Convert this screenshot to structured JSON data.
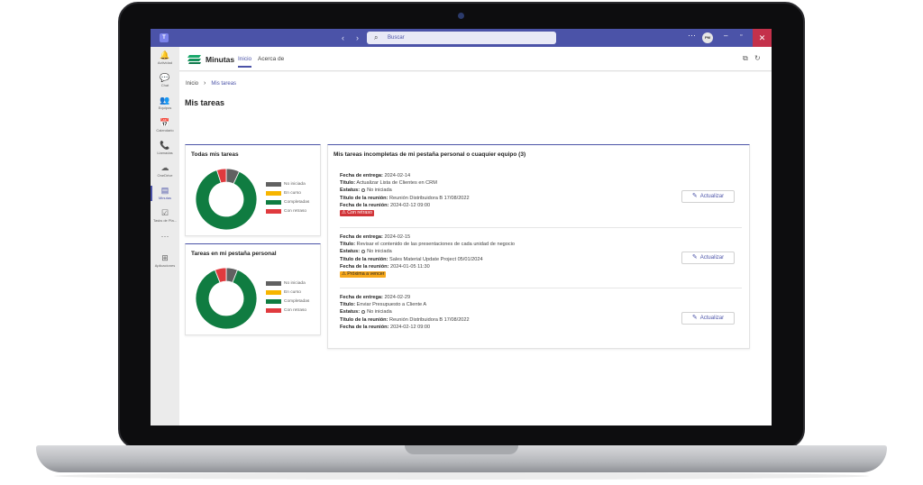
{
  "titlebar": {
    "logo": "T",
    "back_icon": "chevron-left-icon",
    "forward_icon": "chevron-right-icon",
    "search_placeholder": "Buscar",
    "more": "···",
    "avatar_initials": "PM"
  },
  "rail": {
    "items": [
      {
        "label": "Actividad",
        "icon": "bell-icon",
        "glyph": "🔔"
      },
      {
        "label": "Chat",
        "icon": "chat-icon",
        "glyph": "💬"
      },
      {
        "label": "Equipos",
        "icon": "teams-icon",
        "glyph": "👥"
      },
      {
        "label": "Calendario",
        "icon": "calendar-icon",
        "glyph": "📅"
      },
      {
        "label": "Llamadas",
        "icon": "phone-icon",
        "glyph": "📞"
      },
      {
        "label": "OneDrive",
        "icon": "cloud-icon",
        "glyph": "☁"
      },
      {
        "label": "Minutas",
        "icon": "minutas-icon",
        "glyph": "▤"
      },
      {
        "label": "Tasks de Pla...",
        "icon": "tasks-icon",
        "glyph": "☑"
      },
      {
        "label": "",
        "icon": "more-icon",
        "glyph": "···"
      },
      {
        "label": "Aplicaciones",
        "icon": "add-apps-icon",
        "glyph": "⊞"
      }
    ]
  },
  "app": {
    "name": "Minutas",
    "tabs": [
      "Inicio",
      "Acerca de"
    ]
  },
  "breadcrumb": {
    "home": "Inicio",
    "current": "Mis tareas"
  },
  "page_title": "Mis tareas",
  "legend": [
    {
      "label": "No iniciada",
      "color": "#616161"
    },
    {
      "label": "En curso",
      "color": "#f7b500"
    },
    {
      "label": "Completadas",
      "color": "#107c41"
    },
    {
      "label": "Con retraso",
      "color": "#e03a3e"
    }
  ],
  "chart_data": [
    {
      "type": "pie",
      "title": "Todas mis tareas",
      "categories": [
        "No iniciada",
        "En curso",
        "Completadas",
        "Con retraso"
      ],
      "values": [
        7,
        0,
        88,
        5
      ]
    },
    {
      "type": "pie",
      "title": "Tareas en mi pestaña personal",
      "categories": [
        "No iniciada",
        "En curso",
        "Completadas",
        "Con retraso"
      ],
      "values": [
        6,
        0,
        88,
        6
      ]
    }
  ],
  "tasks_panel": {
    "title": "Mis tareas incompletas de mi pestaña personal o cuaquier equipo (3)",
    "labels": {
      "due": "Fecha de entrega:",
      "title": "Título:",
      "status": "Estatus:",
      "meeting": "Título de la reunión:",
      "meeting_date": "Fecha de la reunión:"
    },
    "button_label": "Actualizar",
    "tasks": [
      {
        "due": "2024-02-14",
        "title": "Actualizar Lista de Clientes en CRM",
        "status": "No iniciada",
        "meeting": "Reunión Distribuidora B 17/08/2022",
        "meeting_date": "2024-02-12 09:00",
        "badge": "Con retraso"
      },
      {
        "due": "2024-02-15",
        "title": "Revisar el contenido de las presentaciones de cada unidad de negocio",
        "status": "No iniciada",
        "meeting": "Sales Material Update Project 05/01/2024",
        "meeting_date": "2024-01-05 11:30",
        "badge": "Próxima a vencer"
      },
      {
        "due": "2024-02-29",
        "title": "Enviar Presupuesto a Cliente A",
        "status": "No iniciada",
        "meeting": "Reunión Distribuidora B 17/08/2022",
        "meeting_date": "2024-02-12 09:00",
        "badge": ""
      }
    ]
  }
}
